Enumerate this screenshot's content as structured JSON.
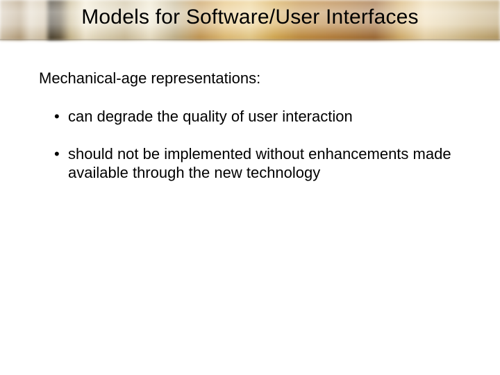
{
  "title": "Models for Software/User Interfaces",
  "subhead": "Mechanical-age representations:",
  "bullets": [
    "can degrade the quality of user interaction",
    "should not be implemented without enhancements made available through the new technology"
  ]
}
